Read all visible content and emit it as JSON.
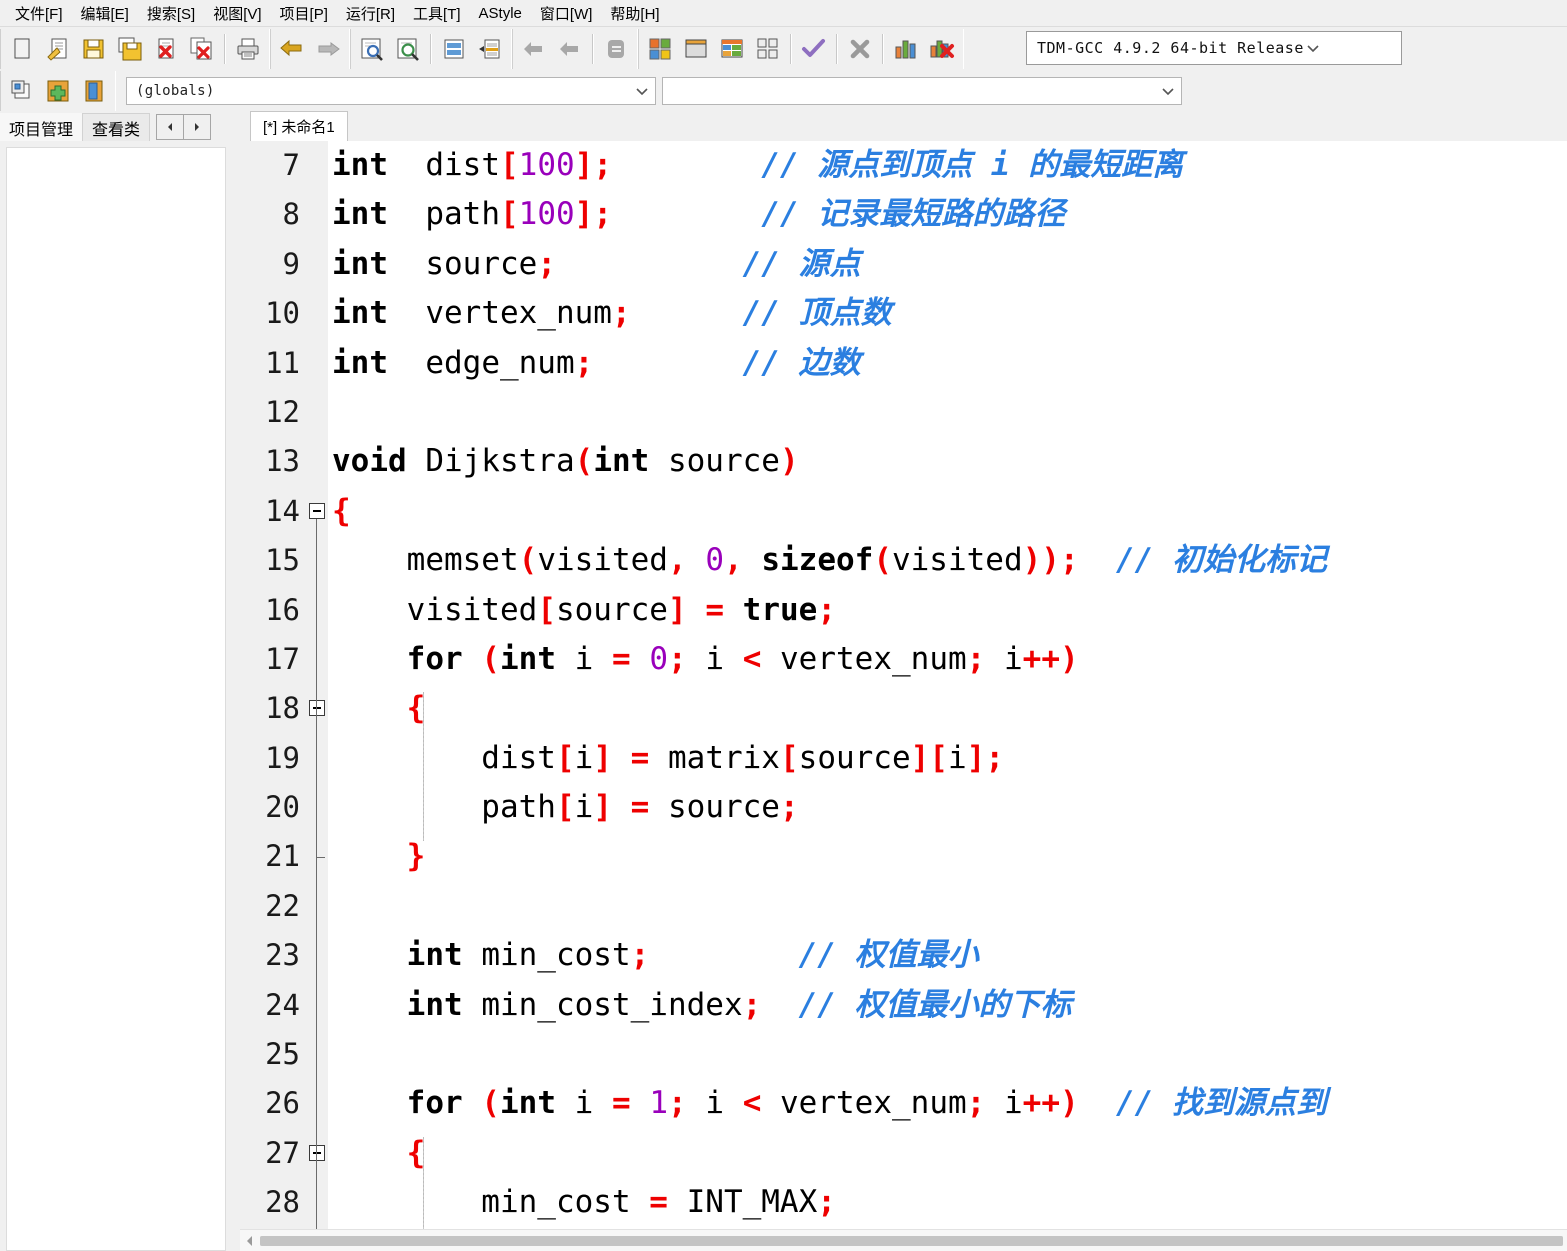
{
  "menu": {
    "items": [
      {
        "label": "文件[F]",
        "name": "menu-file"
      },
      {
        "label": "编辑[E]",
        "name": "menu-edit"
      },
      {
        "label": "搜索[S]",
        "name": "menu-search"
      },
      {
        "label": "视图[V]",
        "name": "menu-view"
      },
      {
        "label": "项目[P]",
        "name": "menu-project"
      },
      {
        "label": "运行[R]",
        "name": "menu-run"
      },
      {
        "label": "工具[T]",
        "name": "menu-tools"
      },
      {
        "label": "AStyle",
        "name": "menu-astyle"
      },
      {
        "label": "窗口[W]",
        "name": "menu-window"
      },
      {
        "label": "帮助[H]",
        "name": "menu-help"
      }
    ]
  },
  "toolbar": {
    "icons": [
      "new-file-icon",
      "open-file-icon",
      "save-icon",
      "save-all-icon",
      "close-file-icon",
      "close-all-icon",
      "print-icon",
      "undo-icon",
      "redo-icon",
      "find-icon",
      "replace-icon",
      "goto-line-icon",
      "toggle-bookmark-icon",
      "step-back-icon",
      "step-forward-icon",
      "abort-icon",
      "build-icon",
      "run-icon",
      "build-and-run-icon",
      "rebuild-icon",
      "compile-check-icon",
      "stop-icon",
      "profile-icon",
      "delete-profile-icon"
    ],
    "compiler_select": {
      "value": "TDM-GCC 4.9.2 64-bit Release",
      "name": "compiler-select"
    }
  },
  "toolbar2": {
    "icons": [
      "new-class-icon",
      "add-member-icon",
      "class-browser-icon"
    ],
    "scope_select": {
      "value": "(globals)",
      "name": "scope-select"
    },
    "symbol_select": {
      "value": "",
      "name": "symbol-select"
    }
  },
  "tabs": {
    "left": [
      {
        "label": "项目管理",
        "active": true
      },
      {
        "label": "查看类",
        "active": false
      }
    ],
    "nav_prev": "◄",
    "nav_next": "►",
    "document": {
      "label": "[*] 未命名1"
    }
  },
  "editor": {
    "first_line": 7,
    "colors": {
      "keyword": "#000000",
      "punctuation": "#ee0000",
      "number": "#9900bb",
      "comment": "#2b7fe0",
      "gutter_bg": "#f0f0f0",
      "editor_bg": "#ffffff"
    },
    "lines": [
      {
        "no": 7,
        "fold": "none",
        "tokens": [
          {
            "t": "int",
            "c": "k"
          },
          {
            "t": "  ",
            "c": "id"
          },
          {
            "t": "dist",
            "c": "id"
          },
          {
            "t": "[",
            "c": "p"
          },
          {
            "t": "100",
            "c": "n"
          },
          {
            "t": "]",
            "c": "p"
          },
          {
            "t": ";",
            "c": "p"
          },
          {
            "t": "        ",
            "c": "id"
          },
          {
            "t": "// 源点到顶点 i 的最短距离",
            "c": "c"
          }
        ]
      },
      {
        "no": 8,
        "fold": "none",
        "tokens": [
          {
            "t": "int",
            "c": "k"
          },
          {
            "t": "  ",
            "c": "id"
          },
          {
            "t": "path",
            "c": "id"
          },
          {
            "t": "[",
            "c": "p"
          },
          {
            "t": "100",
            "c": "n"
          },
          {
            "t": "]",
            "c": "p"
          },
          {
            "t": ";",
            "c": "p"
          },
          {
            "t": "        ",
            "c": "id"
          },
          {
            "t": "// 记录最短路的路径",
            "c": "c"
          }
        ]
      },
      {
        "no": 9,
        "fold": "none",
        "tokens": [
          {
            "t": "int",
            "c": "k"
          },
          {
            "t": "  ",
            "c": "id"
          },
          {
            "t": "source",
            "c": "id"
          },
          {
            "t": ";",
            "c": "p"
          },
          {
            "t": "          ",
            "c": "id"
          },
          {
            "t": "// 源点",
            "c": "c"
          }
        ]
      },
      {
        "no": 10,
        "fold": "none",
        "tokens": [
          {
            "t": "int",
            "c": "k"
          },
          {
            "t": "  ",
            "c": "id"
          },
          {
            "t": "vertex_num",
            "c": "id"
          },
          {
            "t": ";",
            "c": "p"
          },
          {
            "t": "      ",
            "c": "id"
          },
          {
            "t": "// 顶点数",
            "c": "c"
          }
        ]
      },
      {
        "no": 11,
        "fold": "none",
        "tokens": [
          {
            "t": "int",
            "c": "k"
          },
          {
            "t": "  ",
            "c": "id"
          },
          {
            "t": "edge_num",
            "c": "id"
          },
          {
            "t": ";",
            "c": "p"
          },
          {
            "t": "        ",
            "c": "id"
          },
          {
            "t": "// 边数",
            "c": "c"
          }
        ]
      },
      {
        "no": 12,
        "fold": "none",
        "tokens": []
      },
      {
        "no": 13,
        "fold": "none",
        "tokens": [
          {
            "t": "void",
            "c": "k"
          },
          {
            "t": " Dijkstra",
            "c": "id"
          },
          {
            "t": "(",
            "c": "p"
          },
          {
            "t": "int",
            "c": "k"
          },
          {
            "t": " source",
            "c": "id"
          },
          {
            "t": ")",
            "c": "p"
          }
        ]
      },
      {
        "no": 14,
        "fold": "start",
        "tokens": [
          {
            "t": "{",
            "c": "p"
          }
        ]
      },
      {
        "no": 15,
        "fold": "body",
        "tokens": [
          {
            "t": "    memset",
            "c": "id"
          },
          {
            "t": "(",
            "c": "p"
          },
          {
            "t": "visited",
            "c": "id"
          },
          {
            "t": ",",
            "c": "p"
          },
          {
            "t": " ",
            "c": "id"
          },
          {
            "t": "0",
            "c": "n"
          },
          {
            "t": ",",
            "c": "p"
          },
          {
            "t": " ",
            "c": "id"
          },
          {
            "t": "sizeof",
            "c": "k"
          },
          {
            "t": "(",
            "c": "p"
          },
          {
            "t": "visited",
            "c": "id"
          },
          {
            "t": "))",
            "c": "p"
          },
          {
            "t": ";",
            "c": "p"
          },
          {
            "t": "  ",
            "c": "id"
          },
          {
            "t": "// 初始化标记",
            "c": "c"
          }
        ]
      },
      {
        "no": 16,
        "fold": "body",
        "tokens": [
          {
            "t": "    visited",
            "c": "id"
          },
          {
            "t": "[",
            "c": "p"
          },
          {
            "t": "source",
            "c": "id"
          },
          {
            "t": "]",
            "c": "p"
          },
          {
            "t": " ",
            "c": "id"
          },
          {
            "t": "=",
            "c": "p"
          },
          {
            "t": " ",
            "c": "id"
          },
          {
            "t": "true",
            "c": "k"
          },
          {
            "t": ";",
            "c": "p"
          }
        ]
      },
      {
        "no": 17,
        "fold": "body",
        "tokens": [
          {
            "t": "    ",
            "c": "id"
          },
          {
            "t": "for",
            "c": "k"
          },
          {
            "t": " ",
            "c": "id"
          },
          {
            "t": "(",
            "c": "p"
          },
          {
            "t": "int",
            "c": "k"
          },
          {
            "t": " i ",
            "c": "id"
          },
          {
            "t": "=",
            "c": "p"
          },
          {
            "t": " ",
            "c": "id"
          },
          {
            "t": "0",
            "c": "n"
          },
          {
            "t": ";",
            "c": "p"
          },
          {
            "t": " i ",
            "c": "id"
          },
          {
            "t": "<",
            "c": "p"
          },
          {
            "t": " vertex_num",
            "c": "id"
          },
          {
            "t": ";",
            "c": "p"
          },
          {
            "t": " i",
            "c": "id"
          },
          {
            "t": "++)",
            "c": "p"
          }
        ]
      },
      {
        "no": 18,
        "fold": "start2",
        "tokens": [
          {
            "t": "    ",
            "c": "id"
          },
          {
            "t": "{",
            "c": "p"
          }
        ]
      },
      {
        "no": 19,
        "fold": "body2",
        "tokens": [
          {
            "t": "        dist",
            "c": "id"
          },
          {
            "t": "[",
            "c": "p"
          },
          {
            "t": "i",
            "c": "id"
          },
          {
            "t": "]",
            "c": "p"
          },
          {
            "t": " ",
            "c": "id"
          },
          {
            "t": "=",
            "c": "p"
          },
          {
            "t": " matrix",
            "c": "id"
          },
          {
            "t": "[",
            "c": "p"
          },
          {
            "t": "source",
            "c": "id"
          },
          {
            "t": "][",
            "c": "p"
          },
          {
            "t": "i",
            "c": "id"
          },
          {
            "t": "]",
            "c": "p"
          },
          {
            "t": ";",
            "c": "p"
          }
        ]
      },
      {
        "no": 20,
        "fold": "body2",
        "tokens": [
          {
            "t": "        path",
            "c": "id"
          },
          {
            "t": "[",
            "c": "p"
          },
          {
            "t": "i",
            "c": "id"
          },
          {
            "t": "]",
            "c": "p"
          },
          {
            "t": " ",
            "c": "id"
          },
          {
            "t": "=",
            "c": "p"
          },
          {
            "t": " source",
            "c": "id"
          },
          {
            "t": ";",
            "c": "p"
          }
        ]
      },
      {
        "no": 21,
        "fold": "end2",
        "tokens": [
          {
            "t": "    ",
            "c": "id"
          },
          {
            "t": "}",
            "c": "p"
          }
        ]
      },
      {
        "no": 22,
        "fold": "body",
        "tokens": []
      },
      {
        "no": 23,
        "fold": "body",
        "tokens": [
          {
            "t": "    ",
            "c": "id"
          },
          {
            "t": "int",
            "c": "k"
          },
          {
            "t": " min_cost",
            "c": "id"
          },
          {
            "t": ";",
            "c": "p"
          },
          {
            "t": "        ",
            "c": "id"
          },
          {
            "t": "// 权值最小",
            "c": "c"
          }
        ]
      },
      {
        "no": 24,
        "fold": "body",
        "tokens": [
          {
            "t": "    ",
            "c": "id"
          },
          {
            "t": "int",
            "c": "k"
          },
          {
            "t": " min_cost_index",
            "c": "id"
          },
          {
            "t": ";",
            "c": "p"
          },
          {
            "t": "  ",
            "c": "id"
          },
          {
            "t": "// 权值最小的下标",
            "c": "c"
          }
        ]
      },
      {
        "no": 25,
        "fold": "body",
        "tokens": []
      },
      {
        "no": 26,
        "fold": "body",
        "tokens": [
          {
            "t": "    ",
            "c": "id"
          },
          {
            "t": "for",
            "c": "k"
          },
          {
            "t": " ",
            "c": "id"
          },
          {
            "t": "(",
            "c": "p"
          },
          {
            "t": "int",
            "c": "k"
          },
          {
            "t": " i ",
            "c": "id"
          },
          {
            "t": "=",
            "c": "p"
          },
          {
            "t": " ",
            "c": "id"
          },
          {
            "t": "1",
            "c": "n"
          },
          {
            "t": ";",
            "c": "p"
          },
          {
            "t": " i ",
            "c": "id"
          },
          {
            "t": "<",
            "c": "p"
          },
          {
            "t": " vertex_num",
            "c": "id"
          },
          {
            "t": ";",
            "c": "p"
          },
          {
            "t": " i",
            "c": "id"
          },
          {
            "t": "++)",
            "c": "p"
          },
          {
            "t": "  ",
            "c": "id"
          },
          {
            "t": "// 找到源点到",
            "c": "c"
          }
        ]
      },
      {
        "no": 27,
        "fold": "start3",
        "tokens": [
          {
            "t": "    ",
            "c": "id"
          },
          {
            "t": "{",
            "c": "p"
          }
        ]
      },
      {
        "no": 28,
        "fold": "body3",
        "tokens": [
          {
            "t": "        min_cost ",
            "c": "id"
          },
          {
            "t": "=",
            "c": "p"
          },
          {
            "t": " INT_MAX",
            "c": "id"
          },
          {
            "t": ";",
            "c": "p"
          }
        ]
      }
    ]
  },
  "scrollbar": {
    "left_arrow": "◄"
  }
}
